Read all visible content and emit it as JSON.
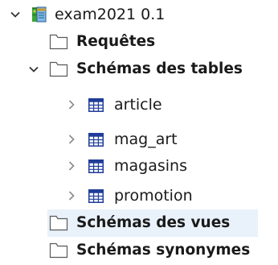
{
  "tree": {
    "root": {
      "label": "exam2021 0.1",
      "icon": "database-project-icon",
      "expanded": true
    },
    "folders": {
      "requetes": {
        "label": "Requêtes",
        "icon": "folder-icon"
      },
      "schemas_tables": {
        "label": "Schémas des tables",
        "icon": "folder-icon",
        "expanded": true,
        "items": [
          {
            "label": "article",
            "icon": "table-icon"
          },
          {
            "label": "mag_art",
            "icon": "table-icon"
          },
          {
            "label": "magasins",
            "icon": "table-icon"
          },
          {
            "label": "promotion",
            "icon": "table-icon"
          }
        ]
      },
      "schemas_vues": {
        "label": "Schémas des vues",
        "icon": "folder-icon",
        "selected": true
      },
      "schemas_synonymes": {
        "label": "Schémas synonymes",
        "icon": "folder-icon"
      }
    }
  },
  "colors": {
    "selection": "#e9f1fa",
    "table_icon": "#1f3d99",
    "folder_outline": "#5a5a5a",
    "chevron": "#6b6b6b",
    "chevron_expanded": "#333333",
    "project_green": "#3aa637"
  }
}
